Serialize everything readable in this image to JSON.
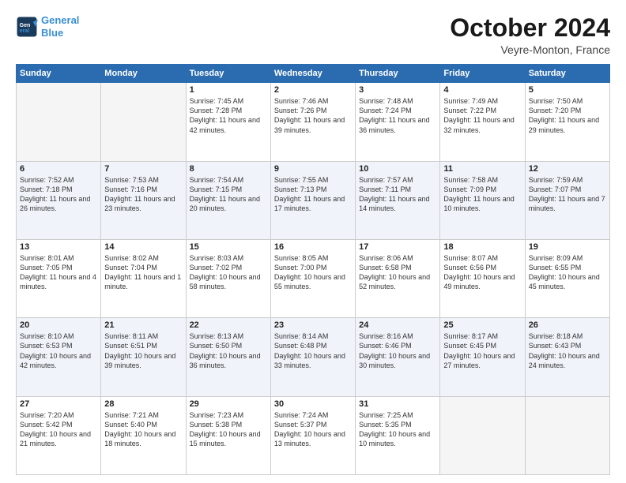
{
  "header": {
    "logo_line1": "General",
    "logo_line2": "Blue",
    "month_title": "October 2024",
    "location": "Veyre-Monton, France"
  },
  "weekdays": [
    "Sunday",
    "Monday",
    "Tuesday",
    "Wednesday",
    "Thursday",
    "Friday",
    "Saturday"
  ],
  "weeks": [
    [
      {
        "day": "",
        "info": ""
      },
      {
        "day": "",
        "info": ""
      },
      {
        "day": "1",
        "info": "Sunrise: 7:45 AM\nSunset: 7:28 PM\nDaylight: 11 hours and 42 minutes."
      },
      {
        "day": "2",
        "info": "Sunrise: 7:46 AM\nSunset: 7:26 PM\nDaylight: 11 hours and 39 minutes."
      },
      {
        "day": "3",
        "info": "Sunrise: 7:48 AM\nSunset: 7:24 PM\nDaylight: 11 hours and 36 minutes."
      },
      {
        "day": "4",
        "info": "Sunrise: 7:49 AM\nSunset: 7:22 PM\nDaylight: 11 hours and 32 minutes."
      },
      {
        "day": "5",
        "info": "Sunrise: 7:50 AM\nSunset: 7:20 PM\nDaylight: 11 hours and 29 minutes."
      }
    ],
    [
      {
        "day": "6",
        "info": "Sunrise: 7:52 AM\nSunset: 7:18 PM\nDaylight: 11 hours and 26 minutes."
      },
      {
        "day": "7",
        "info": "Sunrise: 7:53 AM\nSunset: 7:16 PM\nDaylight: 11 hours and 23 minutes."
      },
      {
        "day": "8",
        "info": "Sunrise: 7:54 AM\nSunset: 7:15 PM\nDaylight: 11 hours and 20 minutes."
      },
      {
        "day": "9",
        "info": "Sunrise: 7:55 AM\nSunset: 7:13 PM\nDaylight: 11 hours and 17 minutes."
      },
      {
        "day": "10",
        "info": "Sunrise: 7:57 AM\nSunset: 7:11 PM\nDaylight: 11 hours and 14 minutes."
      },
      {
        "day": "11",
        "info": "Sunrise: 7:58 AM\nSunset: 7:09 PM\nDaylight: 11 hours and 10 minutes."
      },
      {
        "day": "12",
        "info": "Sunrise: 7:59 AM\nSunset: 7:07 PM\nDaylight: 11 hours and 7 minutes."
      }
    ],
    [
      {
        "day": "13",
        "info": "Sunrise: 8:01 AM\nSunset: 7:05 PM\nDaylight: 11 hours and 4 minutes."
      },
      {
        "day": "14",
        "info": "Sunrise: 8:02 AM\nSunset: 7:04 PM\nDaylight: 11 hours and 1 minute."
      },
      {
        "day": "15",
        "info": "Sunrise: 8:03 AM\nSunset: 7:02 PM\nDaylight: 10 hours and 58 minutes."
      },
      {
        "day": "16",
        "info": "Sunrise: 8:05 AM\nSunset: 7:00 PM\nDaylight: 10 hours and 55 minutes."
      },
      {
        "day": "17",
        "info": "Sunrise: 8:06 AM\nSunset: 6:58 PM\nDaylight: 10 hours and 52 minutes."
      },
      {
        "day": "18",
        "info": "Sunrise: 8:07 AM\nSunset: 6:56 PM\nDaylight: 10 hours and 49 minutes."
      },
      {
        "day": "19",
        "info": "Sunrise: 8:09 AM\nSunset: 6:55 PM\nDaylight: 10 hours and 45 minutes."
      }
    ],
    [
      {
        "day": "20",
        "info": "Sunrise: 8:10 AM\nSunset: 6:53 PM\nDaylight: 10 hours and 42 minutes."
      },
      {
        "day": "21",
        "info": "Sunrise: 8:11 AM\nSunset: 6:51 PM\nDaylight: 10 hours and 39 minutes."
      },
      {
        "day": "22",
        "info": "Sunrise: 8:13 AM\nSunset: 6:50 PM\nDaylight: 10 hours and 36 minutes."
      },
      {
        "day": "23",
        "info": "Sunrise: 8:14 AM\nSunset: 6:48 PM\nDaylight: 10 hours and 33 minutes."
      },
      {
        "day": "24",
        "info": "Sunrise: 8:16 AM\nSunset: 6:46 PM\nDaylight: 10 hours and 30 minutes."
      },
      {
        "day": "25",
        "info": "Sunrise: 8:17 AM\nSunset: 6:45 PM\nDaylight: 10 hours and 27 minutes."
      },
      {
        "day": "26",
        "info": "Sunrise: 8:18 AM\nSunset: 6:43 PM\nDaylight: 10 hours and 24 minutes."
      }
    ],
    [
      {
        "day": "27",
        "info": "Sunrise: 7:20 AM\nSunset: 5:42 PM\nDaylight: 10 hours and 21 minutes."
      },
      {
        "day": "28",
        "info": "Sunrise: 7:21 AM\nSunset: 5:40 PM\nDaylight: 10 hours and 18 minutes."
      },
      {
        "day": "29",
        "info": "Sunrise: 7:23 AM\nSunset: 5:38 PM\nDaylight: 10 hours and 15 minutes."
      },
      {
        "day": "30",
        "info": "Sunrise: 7:24 AM\nSunset: 5:37 PM\nDaylight: 10 hours and 13 minutes."
      },
      {
        "day": "31",
        "info": "Sunrise: 7:25 AM\nSunset: 5:35 PM\nDaylight: 10 hours and 10 minutes."
      },
      {
        "day": "",
        "info": ""
      },
      {
        "day": "",
        "info": ""
      }
    ]
  ]
}
